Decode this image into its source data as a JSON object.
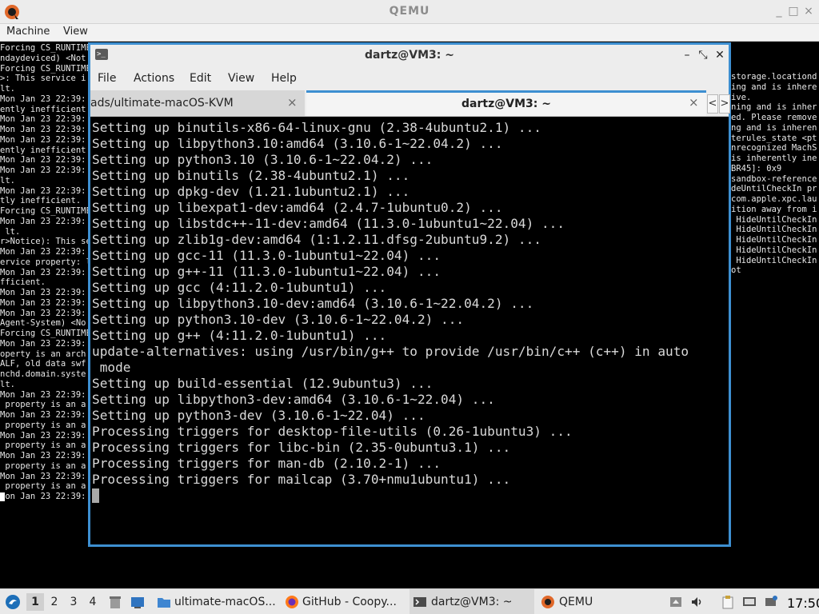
{
  "qemu": {
    "title": "QEMU",
    "controls": {
      "minimize": "_",
      "maximize": "□",
      "close": "×"
    },
    "menu": [
      "Machine",
      "View"
    ]
  },
  "background_log": {
    "left": [
      "Forcing CS_RUNTIME",
      "ndaydeviced) <Not",
      "Forcing CS_RUNTIME",
      ">: This service i",
      "lt.",
      "Mon Jan 23 22:39:",
      "ently inefficient.",
      "Mon Jan 23 22:39:",
      "Mon Jan 23 22:39:",
      "Mon Jan 23 22:39:",
      "ently inefficient",
      "Mon Jan 23 22:39:",
      "Mon Jan 23 22:39:",
      "lt.",
      "Mon Jan 23 22:39:",
      "tly inefficient.",
      "Forcing CS_RUNTIME",
      "Mon Jan 23 22:39:",
      " lt.",
      "r>Notice): This se",
      "Mon Jan 23 22:39:",
      "ervice property: l",
      "Mon Jan 23 22:39:",
      "fficient.",
      "Mon Jan 23 22:39:",
      "Mon Jan 23 22:39:",
      "Mon Jan 23 22:39:",
      "Agent-System) <No",
      "Forcing CS_RUNTIME",
      "Mon Jan 23 22:39:",
      "operty is an arch",
      "ALF, old data swf",
      "nchd.domain.syste",
      "lt.",
      "Mon Jan 23 22:39:",
      " property is an a",
      "Mon Jan 23 22:39:",
      " property is an a",
      "Mon Jan 23 22:39:",
      " property is an a",
      "Mon Jan 23 22:39:",
      " property is an a",
      "Mon Jan 23 22:39:",
      " property is an a",
      "Mon Jan 23 22:39:"
    ],
    "right": [
      "storage.locationd",
      "",
      "ing and is inhere",
      "",
      "",
      "ive.",
      "ning and is inher",
      "",
      "",
      "ed. Please remove",
      "",
      "ng and is inheren",
      "",
      "",
      "terules_state <pt",
      "",
      "nrecognized MachS",
      "",
      "is inherently ine",
      "",
      "BR45]: 0x9",
      "",
      "sandbox-reference",
      "",
      "",
      "deUntilCheckIn pr",
      "",
      "com.apple.xpc.lau",
      "ition away from i",
      "",
      " HideUntilCheckIn",
      "",
      " HideUntilCheckIn",
      "",
      " HideUntilCheckIn",
      "",
      " HideUntilCheckIn",
      "",
      " HideUntilCheckIn",
      "",
      "ot"
    ]
  },
  "terminal": {
    "title": "dartz@VM3: ~",
    "controls": {
      "minimize": "–",
      "restore": "⤡",
      "close": "✕"
    },
    "menu": [
      "File",
      "Actions",
      "Edit",
      "View",
      "Help"
    ],
    "tabs": [
      {
        "label": "ads/ultimate-macOS-KVM",
        "active": false
      },
      {
        "label": "dartz@VM3: ~",
        "active": true
      }
    ],
    "tab_close": "×",
    "tab_prev": "<",
    "tab_next": ">",
    "lines": [
      "Setting up binutils-x86-64-linux-gnu (2.38-4ubuntu2.1) ...",
      "Setting up libpython3.10:amd64 (3.10.6-1~22.04.2) ...",
      "Setting up python3.10 (3.10.6-1~22.04.2) ...",
      "Setting up binutils (2.38-4ubuntu2.1) ...",
      "Setting up dpkg-dev (1.21.1ubuntu2.1) ...",
      "Setting up libexpat1-dev:amd64 (2.4.7-1ubuntu0.2) ...",
      "Setting up libstdc++-11-dev:amd64 (11.3.0-1ubuntu1~22.04) ...",
      "Setting up zlib1g-dev:amd64 (1:1.2.11.dfsg-2ubuntu9.2) ...",
      "Setting up gcc-11 (11.3.0-1ubuntu1~22.04) ...",
      "Setting up g++-11 (11.3.0-1ubuntu1~22.04) ...",
      "Setting up gcc (4:11.2.0-1ubuntu1) ...",
      "Setting up libpython3.10-dev:amd64 (3.10.6-1~22.04.2) ...",
      "Setting up python3.10-dev (3.10.6-1~22.04.2) ...",
      "Setting up g++ (4:11.2.0-1ubuntu1) ...",
      "update-alternatives: using /usr/bin/g++ to provide /usr/bin/c++ (c++) in auto",
      " mode",
      "Setting up build-essential (12.9ubuntu3) ...",
      "Setting up libpython3-dev:amd64 (3.10.6-1~22.04) ...",
      "Setting up python3-dev (3.10.6-1~22.04) ...",
      "Processing triggers for desktop-file-utils (0.26-1ubuntu3) ...",
      "Processing triggers for libc-bin (2.35-0ubuntu3.1) ...",
      "Processing triggers for man-db (2.10.2-1) ...",
      "Processing triggers for mailcap (3.70+nmu1ubuntu1) ..."
    ]
  },
  "taskbar": {
    "workspaces": [
      "1",
      "2",
      "3",
      "4"
    ],
    "tasks": [
      {
        "label": "ultimate-macOS...",
        "icon": "folder-icon"
      },
      {
        "label": "GitHub - Coopy...",
        "icon": "firefox-icon"
      },
      {
        "label": "dartz@VM3: ~",
        "icon": "terminal-icon"
      },
      {
        "label": "QEMU",
        "icon": "qemu-icon"
      }
    ],
    "clock": "17:50"
  },
  "colors": {
    "accent": "#3d8fd1",
    "terminal_bg": "#000000",
    "terminal_fg": "#d9d9d9",
    "chrome": "#ededed"
  }
}
